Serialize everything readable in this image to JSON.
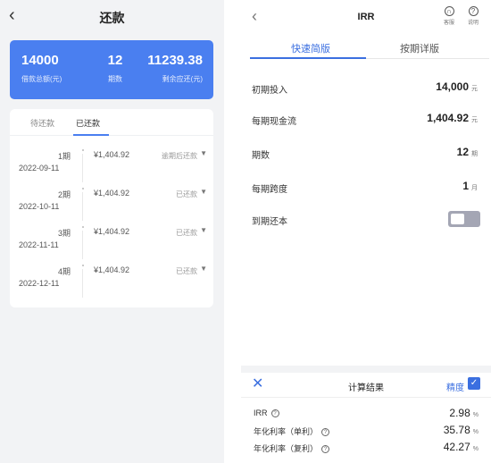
{
  "left": {
    "title": "还款",
    "back_icon": "‹",
    "summary": {
      "total": {
        "value": "14000",
        "label": "借款总额(元)"
      },
      "periods": {
        "value": "12",
        "label": "期数"
      },
      "remaining": {
        "value": "11239.38",
        "label": "剩余应还(元)"
      }
    },
    "tabs": [
      "待还款",
      "已还款"
    ],
    "active_tab": "已还款",
    "rows": [
      {
        "period": "1期",
        "date": "2022-09-11",
        "amount": "¥1,404.92",
        "status": "逾期后还款"
      },
      {
        "period": "2期",
        "date": "2022-10-11",
        "amount": "¥1,404.92",
        "status": "已还款"
      },
      {
        "period": "3期",
        "date": "2022-11-11",
        "amount": "¥1,404.92",
        "status": "已还款"
      },
      {
        "period": "4期",
        "date": "2022-12-11",
        "amount": "¥1,404.92",
        "status": "已还款"
      }
    ]
  },
  "right": {
    "title": "IRR",
    "back_icon": "‹",
    "nav_icons": {
      "service": {
        "icon": "headset-icon",
        "label": "客服"
      },
      "help": {
        "icon": "question-icon",
        "label": "说明"
      }
    },
    "segments": {
      "quick": "快速简版",
      "detail": "按期详版",
      "active": "快速简版"
    },
    "fields": {
      "initial": {
        "label": "初期投入",
        "value": "14,000",
        "unit": "元"
      },
      "cashflow": {
        "label": "每期现金流",
        "value": "1,404.92",
        "unit": "元"
      },
      "periods": {
        "label": "期数",
        "value": "12",
        "unit": "期"
      },
      "span": {
        "label": "每期跨度",
        "value": "1",
        "unit": "月"
      },
      "balloon": {
        "label": "到期还本",
        "toggle_on": false
      }
    },
    "result": {
      "title": "计算结果",
      "precision_label": "精度",
      "precision_checked": true,
      "rows": [
        {
          "label": "IRR",
          "value": "2.98",
          "unit": "%"
        },
        {
          "label": "年化利率（单利）",
          "value": "35.78",
          "unit": "%"
        },
        {
          "label": "年化利率（复利）",
          "value": "42.27",
          "unit": "%"
        }
      ]
    }
  },
  "colors": {
    "accent": "#4a7ff0",
    "link": "#3b6fe0",
    "toggle_off": "#a4a6b4"
  }
}
